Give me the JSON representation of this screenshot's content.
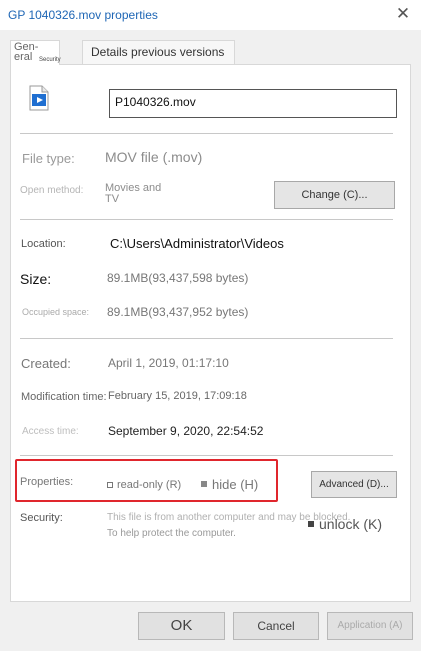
{
  "window": {
    "title": "GP 1040326.mov properties",
    "close_glyph": "✕"
  },
  "tabs": {
    "general_line1": "Gen-",
    "general_line2": "eral",
    "general_small": "Security",
    "details": "Details previous versions"
  },
  "file": {
    "icon": "video-file-icon",
    "name": "P1040326.mov"
  },
  "fields": {
    "file_type_label": "File type:",
    "file_type_value": "MOV file (.mov)",
    "open_method_label": "Open method:",
    "open_method_value_line1": "Movies and",
    "open_method_value_line2": "TV",
    "change_button": "Change (C)...",
    "location_label": "Location:",
    "location_value": "C:\\Users\\Administrator\\Videos",
    "size_label": "Size:",
    "size_value": "89.1MB(93,437,598 bytes)",
    "occupied_label": "Occupied space:",
    "occupied_value": "89.1MB(93,437,952 bytes)",
    "created_label": "Created:",
    "created_value": "April 1, 2019, 01:17:10",
    "modified_label": "Modification time:",
    "modified_value": "February 15, 2019, 17:09:18",
    "accessed_label": "Access time:",
    "accessed_value": "September 9, 2020, 22:54:52"
  },
  "attributes": {
    "label": "Properties:",
    "readonly_label": "read-only (R)",
    "hide_label": "hide (H)",
    "advanced_button": "Advanced (D)..."
  },
  "security": {
    "label": "Security:",
    "message_line1": "This file is from another computer and may be blocked.",
    "message_line2": "To help protect the computer.",
    "unlock_label": "unlock (K)"
  },
  "footer": {
    "ok": "OK",
    "cancel": "Cancel",
    "apply": "Application (A)"
  },
  "colors": {
    "title": "#1e66b5",
    "highlight_box": "#e0262d",
    "panel_bg": "#ffffff",
    "window_bg": "#f0f0f0"
  }
}
